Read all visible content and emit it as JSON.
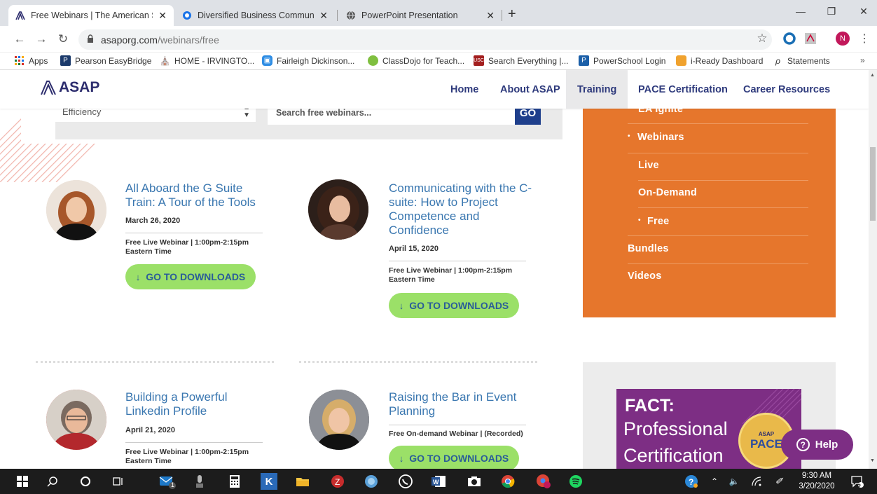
{
  "browser": {
    "tabs": [
      {
        "label": "Free Webinars | The American Society of Administrative Professionals",
        "close": "✕"
      },
      {
        "label": "Diversified Business Communications",
        "close": "✕"
      },
      {
        "label": "PowerPoint Presentation",
        "close": "✕"
      }
    ],
    "new_tab": "+",
    "address_host": "asaporg.com",
    "address_path": "/webinars/free",
    "profile_initial": "N",
    "bookmarks": [
      {
        "label": "Apps"
      },
      {
        "label": "Pearson EasyBridge"
      },
      {
        "label": "HOME - IRVINGTO..."
      },
      {
        "label": "Fairleigh Dickinson..."
      },
      {
        "label": "ClassDojo for Teach..."
      },
      {
        "label": "Search Everything |..."
      },
      {
        "label": "PowerSchool Login"
      },
      {
        "label": "i-Ready Dashboard"
      },
      {
        "label": "Statements"
      }
    ],
    "bookmarks_more": "»"
  },
  "site": {
    "logo_text": "ASAP",
    "nav": [
      "Home",
      "About ASAP",
      "Training",
      "PACE Certification",
      "Career Resources"
    ],
    "filter": {
      "select_value": "Efficiency",
      "search_placeholder": "Search free webinars...",
      "go_label": "GO"
    },
    "sidebar_menu": [
      "EA Ignite",
      "Webinars",
      "Live",
      "On-Demand",
      "Free",
      "Bundles",
      "Videos"
    ],
    "webinars": [
      {
        "title": "All Aboard the G Suite Train: A Tour of the Tools",
        "date": "March 26, 2020",
        "info_1": "Free Live Webinar | 1:00pm-2:15pm",
        "info_2": "Eastern Time",
        "button": "GO TO DOWNLOADS"
      },
      {
        "title": "Communicating with the C-suite: How to Project Competence and Confidence",
        "date": "April 15, 2020",
        "info_1": "Free Live Webinar | 1:00pm-2:15pm",
        "info_2": "Eastern Time",
        "button": "GO TO DOWNLOADS"
      },
      {
        "title": "Building a Powerful Linkedin Profile",
        "date": "April 21, 2020",
        "info_1": "Free Live Webinar | 1:00pm-2:15pm",
        "info_2": "Eastern Time"
      },
      {
        "title": "Raising the Bar in Event Planning",
        "info_1": "Free On-demand Webinar | (Recorded)",
        "button": "GO TO DOWNLOADS"
      }
    ],
    "fact_banner": {
      "title": "FACT:",
      "line_1": "Professional",
      "line_2": "Certification",
      "badge_top": "ASAP",
      "badge_main": "PACE"
    },
    "help_label": "Help"
  },
  "taskbar": {
    "time": "9:30 AM",
    "date": "3/20/2020",
    "mail_badge": "1",
    "notif_badge": "2"
  }
}
